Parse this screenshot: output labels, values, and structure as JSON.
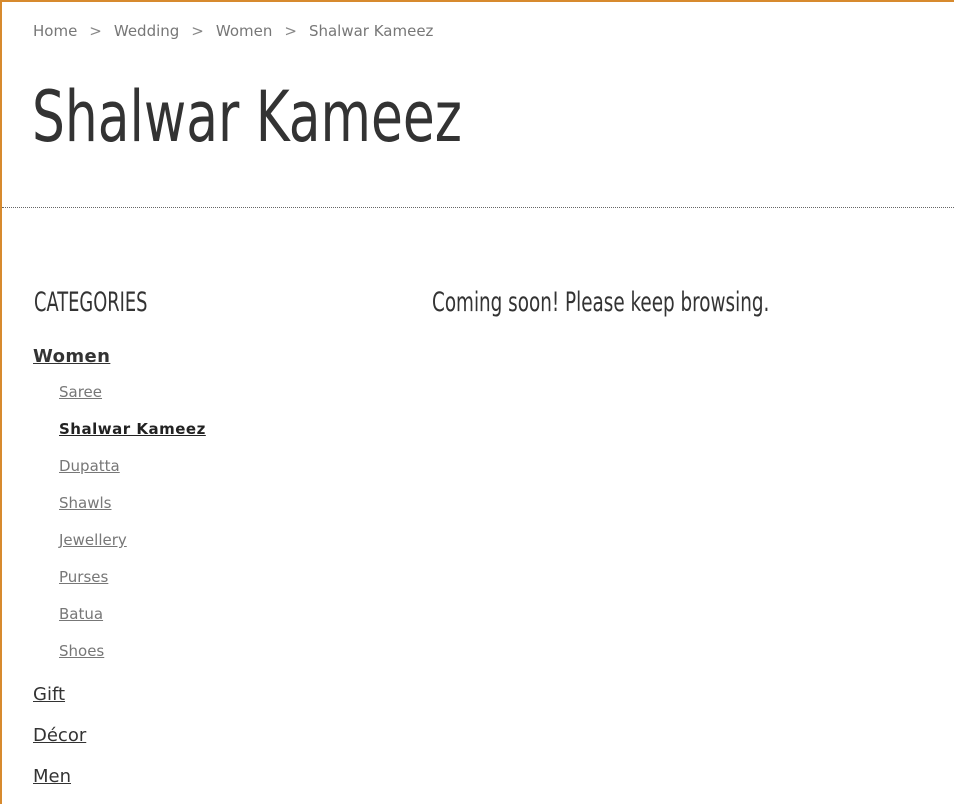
{
  "breadcrumb": {
    "items": [
      "Home",
      "Wedding",
      "Women",
      "Shalwar Kameez"
    ],
    "separator": ">"
  },
  "page_title": "Shalwar Kameez",
  "sidebar": {
    "heading": "CATEGORIES",
    "categories": [
      {
        "label": "Women",
        "expanded": true,
        "children": [
          {
            "label": "Saree"
          },
          {
            "label": "Shalwar Kameez",
            "active": true
          },
          {
            "label": "Dupatta"
          },
          {
            "label": "Shawls"
          },
          {
            "label": "Jewellery"
          },
          {
            "label": "Purses"
          },
          {
            "label": "Batua"
          },
          {
            "label": "Shoes"
          }
        ]
      },
      {
        "label": "Gift"
      },
      {
        "label": "Décor"
      },
      {
        "label": "Men"
      }
    ]
  },
  "main": {
    "message": "Coming soon! Please keep browsing."
  },
  "colors": {
    "accent_border": "#d78a2e",
    "text_dark": "#333333",
    "text_muted": "#777777"
  }
}
